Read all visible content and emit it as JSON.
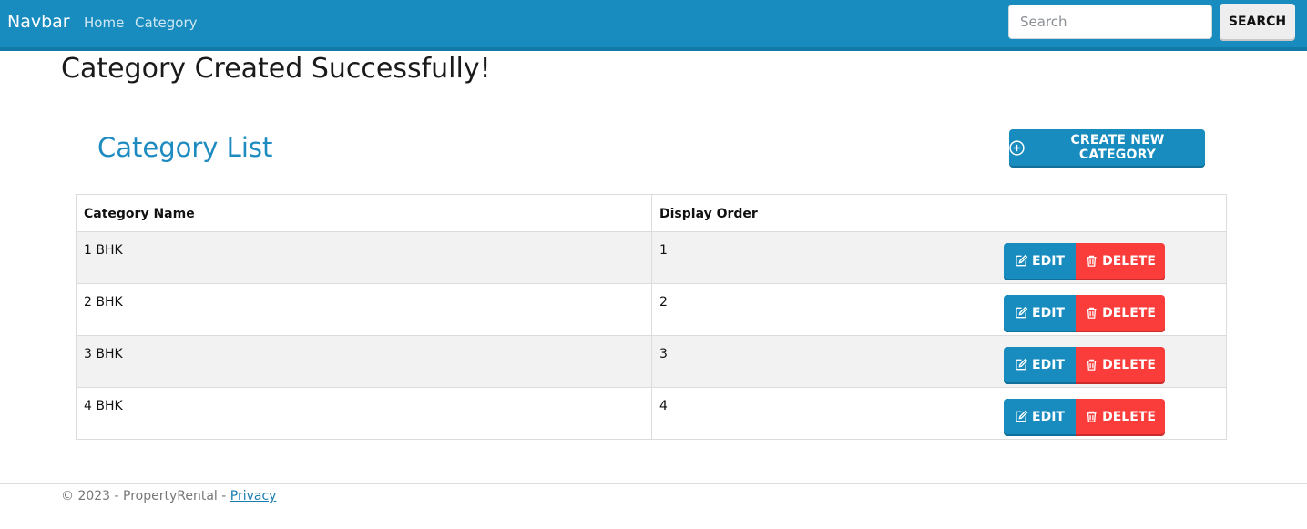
{
  "navbar": {
    "brand": "Navbar",
    "links": [
      "Home",
      "Category"
    ],
    "search": {
      "placeholder": "Search",
      "value": ""
    },
    "search_button": "SEARCH"
  },
  "alert": {
    "message": "Category Created Successfully!"
  },
  "main": {
    "title": "Category List",
    "create_button": "CREATE NEW CATEGORY",
    "table": {
      "headers": [
        "Category Name",
        "Display Order",
        ""
      ],
      "rows": [
        {
          "name": "1 BHK",
          "order": "1",
          "edit": "EDIT",
          "delete": "DELETE"
        },
        {
          "name": "2 BHK",
          "order": "2",
          "edit": "EDIT",
          "delete": "DELETE"
        },
        {
          "name": "3 BHK",
          "order": "3",
          "edit": "EDIT",
          "delete": "DELETE"
        },
        {
          "name": "4 BHK",
          "order": "4",
          "edit": "EDIT",
          "delete": "DELETE"
        }
      ]
    }
  },
  "footer": {
    "text": "© 2023 - PropertyRental - ",
    "privacy_link": "Privacy"
  },
  "colors": {
    "primary": "#188cbf",
    "danger": "#fa3c3a",
    "title": "#1e8bc0"
  },
  "icons": {
    "create": "plus-circle-icon",
    "edit": "edit-icon",
    "delete": "trash-icon"
  }
}
